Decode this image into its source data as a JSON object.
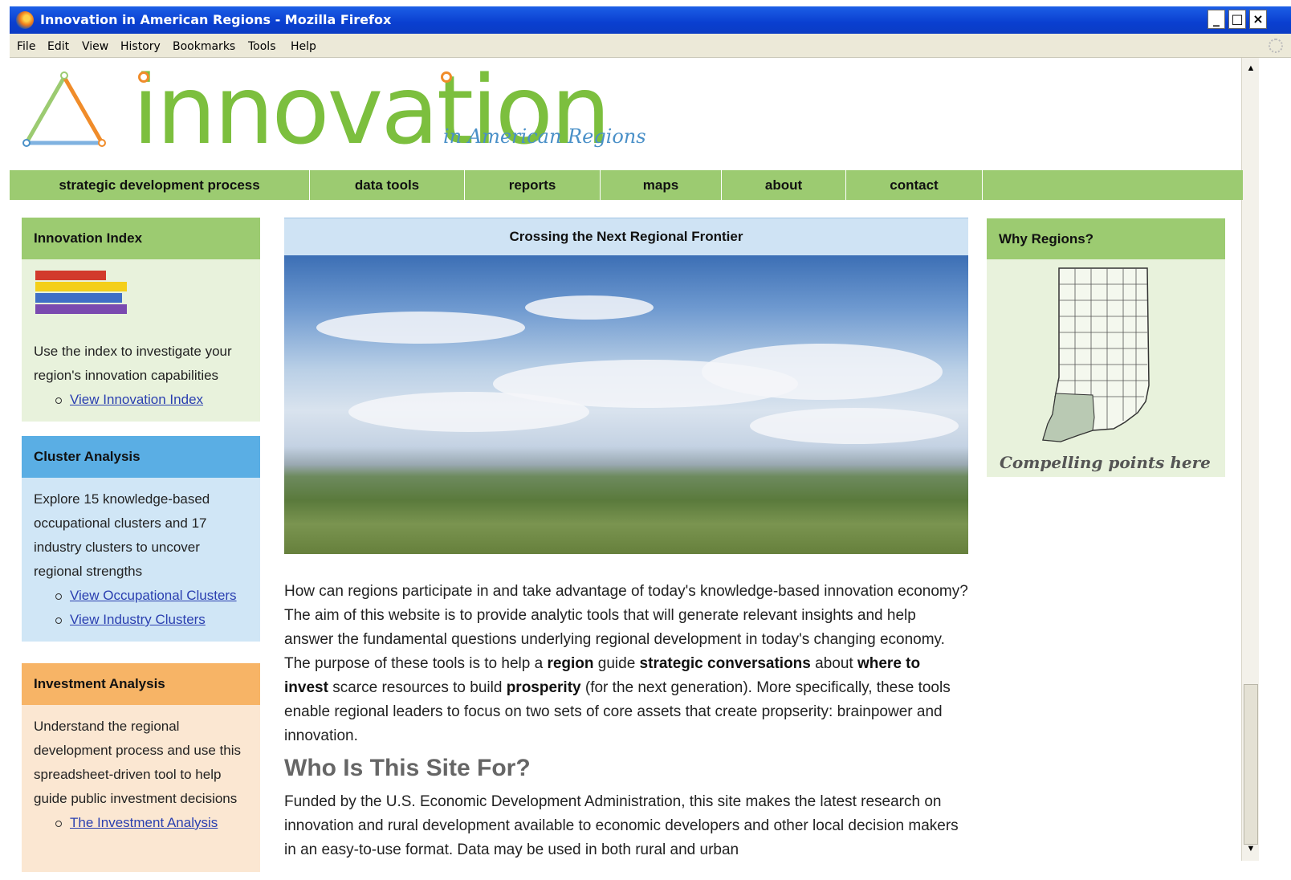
{
  "window": {
    "title": "Innovation in American Regions - Mozilla Firefox"
  },
  "menu": [
    "File",
    "Edit",
    "View",
    "History",
    "Bookmarks",
    "Tools",
    "Help"
  ],
  "logo": {
    "word": "innovation",
    "sub": "in American Regions"
  },
  "nav": [
    "strategic development process",
    "data tools",
    "reports",
    "maps",
    "about",
    "contact"
  ],
  "colors": {
    "green": "#9ccb71",
    "blue": "#5aaee4",
    "orange": "#f7b466",
    "logo_green": "#7cbf3e",
    "accent_orange": "#f08c2a"
  },
  "innovation_index": {
    "title": "Innovation Index",
    "text": "Use the index to investigate your region's innovation capabilities",
    "links": [
      "View Innovation Index"
    ]
  },
  "cluster_analysis": {
    "title": "Cluster Analysis",
    "text": "Explore 15 knowledge-based occupational clusters and 17 industry clusters to uncover regional strengths",
    "links": [
      "View Occupational Clusters",
      "View Industry Clusters"
    ]
  },
  "investment_analysis": {
    "title": "Investment Analysis",
    "text": "Understand the regional development process and use this spreadsheet-driven tool to help guide public investment decisions",
    "links": [
      "The Investment Analysis"
    ]
  },
  "feature": {
    "caption": "Crossing the Next Regional Frontier"
  },
  "intro": {
    "p1": "How can regions participate in and take advantage of today's knowledge-based innovation economy? The aim of this website is to provide analytic tools that will generate relevant insights and help answer the fundamental questions underlying regional development in today's changing economy. The purpose of these tools is to help a ",
    "b1": "region",
    "p2": " guide ",
    "b2": "strategic conversations",
    "p3": " about ",
    "b3": "where to invest",
    "p4": " scarce resources to build ",
    "b4": "prosperity",
    "p5": " (for the next generation). More specifically, these tools enable regional leaders to focus on two sets of core assets that create propserity: brainpower and innovation."
  },
  "who": {
    "title": "Who Is This Site For?",
    "text": "Funded by the U.S. Economic Development Administration, this site makes the latest research on innovation and rural development available to economic developers and other local decision makers in an easy-to-use format. Data may be used in both rural and urban"
  },
  "why_regions": {
    "title": "Why Regions?",
    "caption": "Compelling points here"
  }
}
